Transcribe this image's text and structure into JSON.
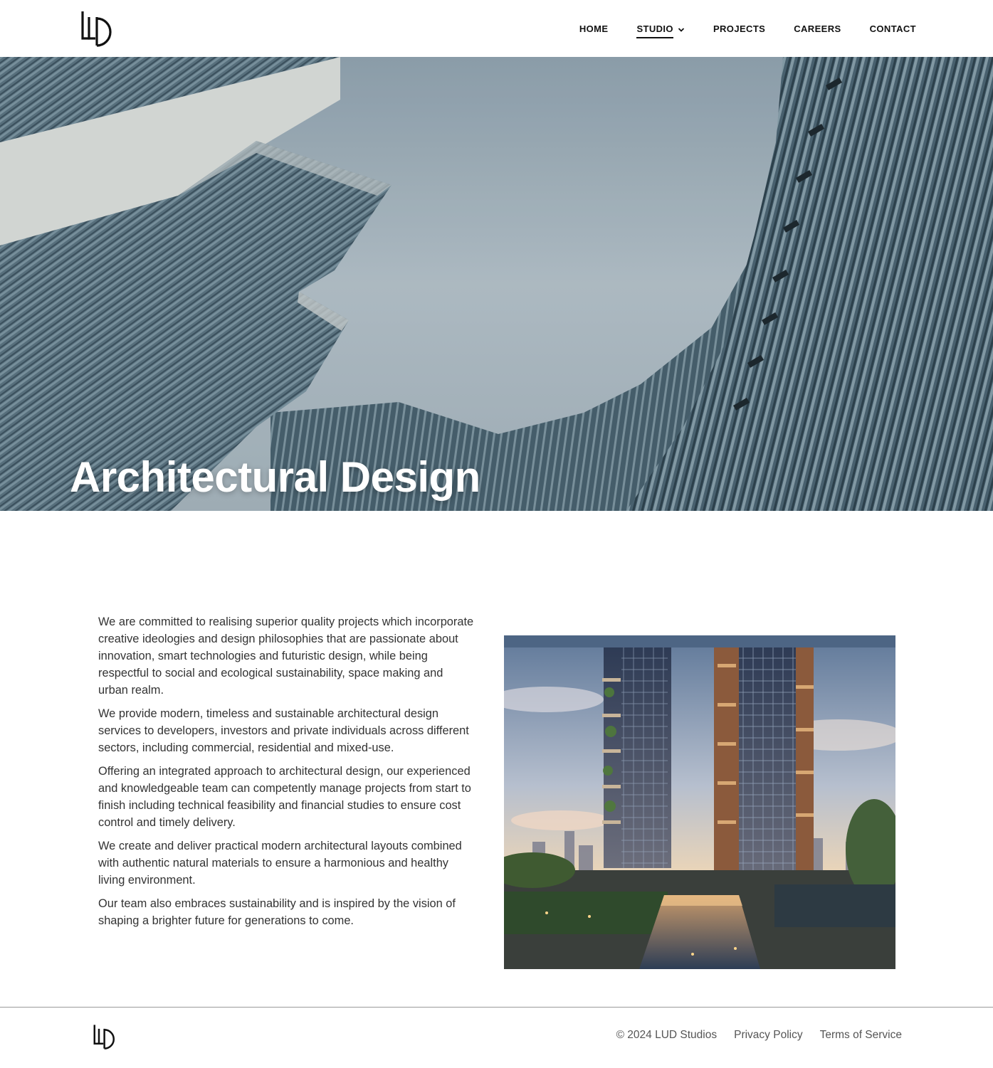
{
  "header": {
    "nav": [
      {
        "label": "HOME"
      },
      {
        "label": "STUDIO"
      },
      {
        "label": "PROJECTS"
      },
      {
        "label": "CAREERS"
      },
      {
        "label": "CONTACT"
      }
    ],
    "active_nav": "STUDIO",
    "logo_icon": "lud-logo-icon"
  },
  "hero": {
    "title": "Architectural Design"
  },
  "main": {
    "paragraphs": [
      "We are committed to realising superior quality projects which incorporate creative ideologies and design philosophies that are passionate about innovation, smart technologies and futuristic design, while being respectful to social and ecological sustainability, space making and urban realm.",
      "We provide modern, timeless and sustainable architectural design services to developers, investors and private individuals across different sectors, including commercial, residential and mixed-use.",
      "Offering an integrated approach to architectural design, our experienced and knowledgeable team can competently manage projects from start to finish including technical feasibility and financial studies to ensure cost control and timely delivery.",
      "We create and deliver practical modern architectural layouts combined with authentic natural materials to ensure a harmonious and healthy living environment.",
      "Our team also embraces sustainability and is inspired by the vision of shaping a brighter future for generations to come."
    ]
  },
  "footer": {
    "copyright": "© 2024 LUD Studios",
    "privacy": "Privacy Policy",
    "terms": "Terms of Service"
  },
  "colors": {
    "text": "#111111",
    "body_text": "#333333",
    "sky": "#b4c3cc",
    "facade": "#55707e"
  }
}
